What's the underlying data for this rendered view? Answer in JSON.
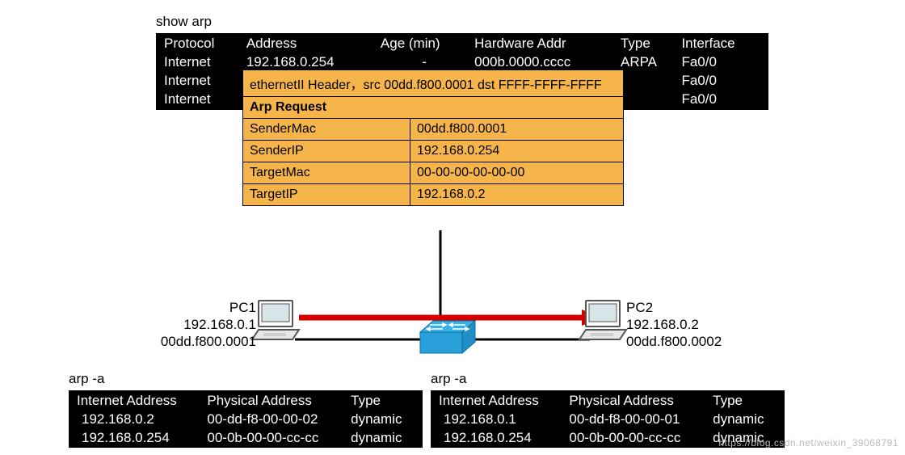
{
  "router": {
    "command": "show arp",
    "headers": [
      "Protocol",
      "Address",
      "Age (min)",
      "Hardware Addr",
      "Type",
      "Interface"
    ],
    "rows": [
      {
        "protocol": "Internet",
        "address": "192.168.0.254",
        "age": "-",
        "hwaddr": "000b.0000.cccc",
        "arptype": "ARPA",
        "iface": "Fa0/0"
      },
      {
        "protocol": "Internet",
        "address": "",
        "age": "",
        "hwaddr": "",
        "arptype": "",
        "iface": "Fa0/0"
      },
      {
        "protocol": "Internet",
        "address": "",
        "age": "",
        "hwaddr": "",
        "arptype": "",
        "iface": "Fa0/0"
      }
    ]
  },
  "packet": {
    "eth_header": "ethernetII Header，src 00dd.f800.0001 dst FFFF-FFFF-FFFF",
    "title": "Arp Request",
    "fields": [
      {
        "k": "SenderMac",
        "v": "00dd.f800.0001"
      },
      {
        "k": "SenderIP",
        "v": "192.168.0.254"
      },
      {
        "k": "TargetMac",
        "v": "00-00-00-00-00-00"
      },
      {
        "k": "TargetIP",
        "v": "192.168.0.2"
      }
    ]
  },
  "pc1": {
    "name": "PC1",
    "ip": "192.168.0.1",
    "mac": "00dd.f800.0001"
  },
  "pc2": {
    "name": "PC2",
    "ip": "192.168.0.2",
    "mac": "00dd.f800.0002"
  },
  "arp_left": {
    "command": "arp -a",
    "headers": [
      "Internet Address",
      "Physical Address",
      "Type"
    ],
    "rows": [
      {
        "ip": "192.168.0.2",
        "mac": "00-dd-f8-00-00-02",
        "type": "dynamic"
      },
      {
        "ip": "192.168.0.254",
        "mac": "00-0b-00-00-cc-cc",
        "type": "dynamic"
      }
    ]
  },
  "arp_right": {
    "command": "arp -a",
    "headers": [
      "Internet Address",
      "Physical Address",
      "Type"
    ],
    "rows": [
      {
        "ip": "192.168.0.1",
        "mac": "00-dd-f8-00-00-01",
        "type": "dynamic"
      },
      {
        "ip": "192.168.0.254",
        "mac": "00-0b-00-00-cc-cc",
        "type": "dynamic"
      }
    ]
  },
  "watermark": "https://blog.csdn.net/weixin_39068791"
}
